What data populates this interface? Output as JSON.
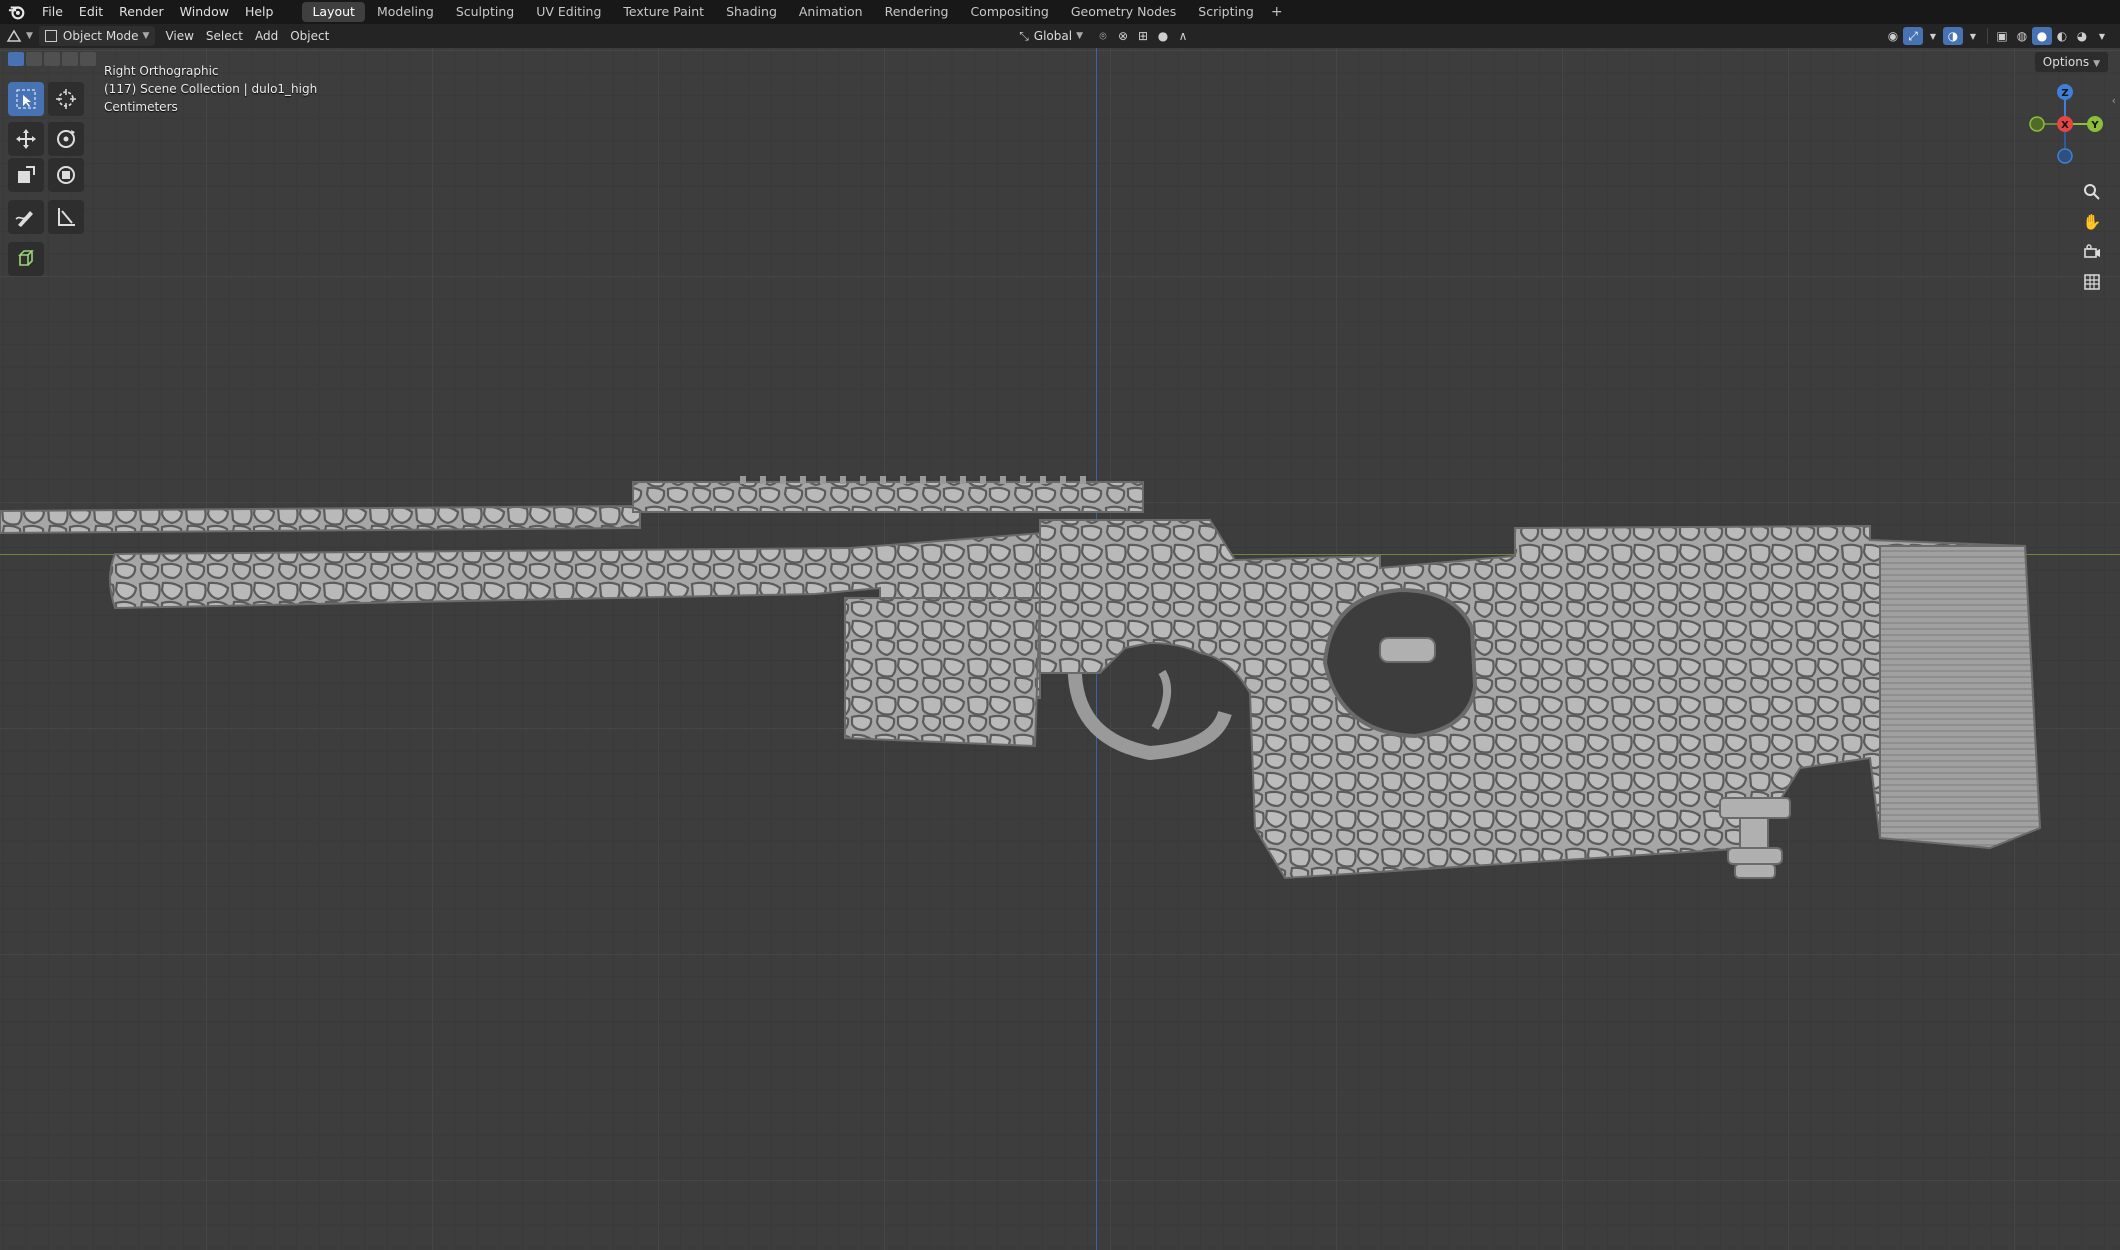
{
  "menu": [
    "File",
    "Edit",
    "Render",
    "Window",
    "Help"
  ],
  "workspaces": [
    "Layout",
    "Modeling",
    "Sculpting",
    "UV Editing",
    "Texture Paint",
    "Shading",
    "Animation",
    "Rendering",
    "Compositing",
    "Geometry Nodes",
    "Scripting"
  ],
  "active_workspace": "Layout",
  "header": {
    "mode": "Object Mode",
    "view": "View",
    "select": "Select",
    "add": "Add",
    "object": "Object",
    "transform_orientation": "Global"
  },
  "viewport": {
    "view_name": "Right Orthographic",
    "collection_info": "(117) Scene Collection | dulo1_high",
    "units": "Centimeters",
    "options": "Options"
  },
  "gizmo": {
    "z": "Z",
    "x": "X",
    "y": "Y"
  },
  "colors": {
    "accent": "#4772b3",
    "axis_x": "#e54545",
    "axis_y": "#8bbf3a",
    "axis_z": "#3d7fd9",
    "mesh": "#a9a9a9"
  },
  "icons": [
    "blender-logo",
    "select-box-icon",
    "cursor-icon",
    "move-icon",
    "rotate-icon",
    "scale-icon",
    "transform-icon",
    "annotate-icon",
    "measure-icon",
    "add-cube-icon",
    "zoom-icon",
    "hand-pan-icon",
    "camera-icon",
    "grid-icon"
  ]
}
